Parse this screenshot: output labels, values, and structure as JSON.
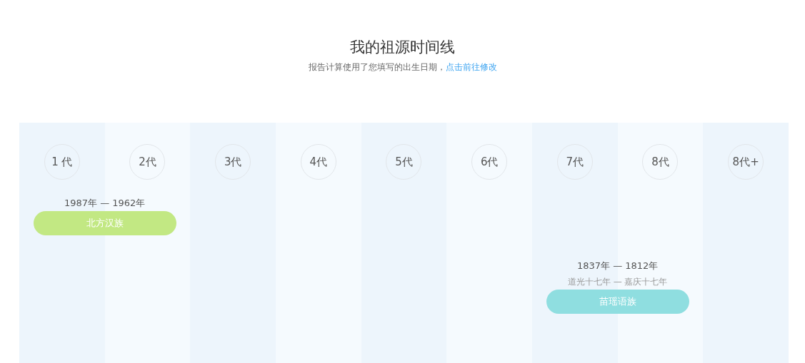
{
  "header": {
    "title": "我的祖源时间线",
    "note": "报告计算使用了您填写的出生日期，",
    "link": "点击前往修改"
  },
  "generations": [
    {
      "label": "1 代",
      "entry": {
        "years": "1987年 — 1962年",
        "group": "北方汉族",
        "color": "#c2e883"
      }
    },
    {
      "label": "2代"
    },
    {
      "label": "3代"
    },
    {
      "label": "4代"
    },
    {
      "label": "5代"
    },
    {
      "label": "6代"
    },
    {
      "label": "7代",
      "entry": {
        "years": "1837年 — 1812年",
        "era": "道光十七年 — 嘉庆十七年",
        "group": "苗瑶语族",
        "color": "#8fdee0"
      }
    },
    {
      "label": "8代"
    },
    {
      "label": "8代+"
    }
  ]
}
